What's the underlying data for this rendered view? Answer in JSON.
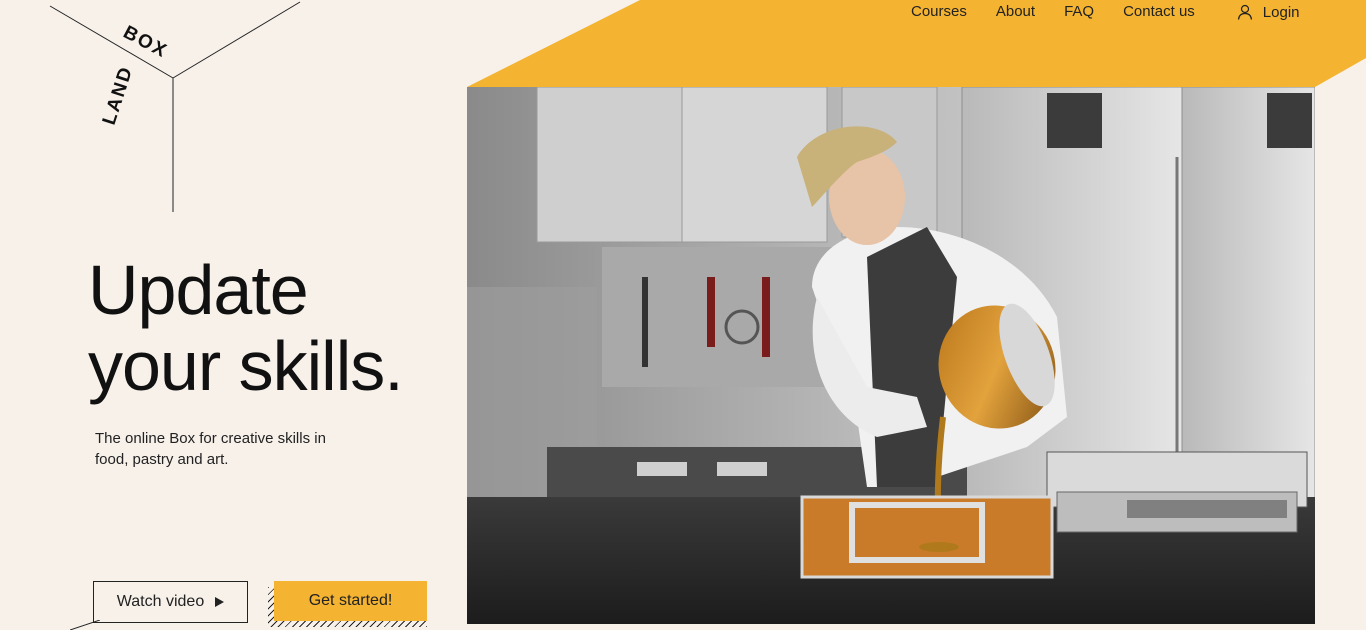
{
  "brand": {
    "logo_text": "LANDBOX"
  },
  "nav": {
    "links": [
      "Courses",
      "About",
      "FAQ",
      "Contact us"
    ],
    "login_label": "Login"
  },
  "hero": {
    "title_line1": "Update",
    "title_line2": "your skills.",
    "subtitle": "The online Box for creative skills in food, pastry and art.",
    "watch_video_label": "Watch video",
    "get_started_label": "Get started!"
  },
  "colors": {
    "accent": "#f4b331",
    "background": "#f7f1ea",
    "text": "#111111"
  },
  "icons": {
    "login": "user-icon",
    "play": "play-triangle-icon"
  },
  "photo": {
    "subject": "chef pouring caramel into a metal frame in a stainless steel kitchen"
  }
}
